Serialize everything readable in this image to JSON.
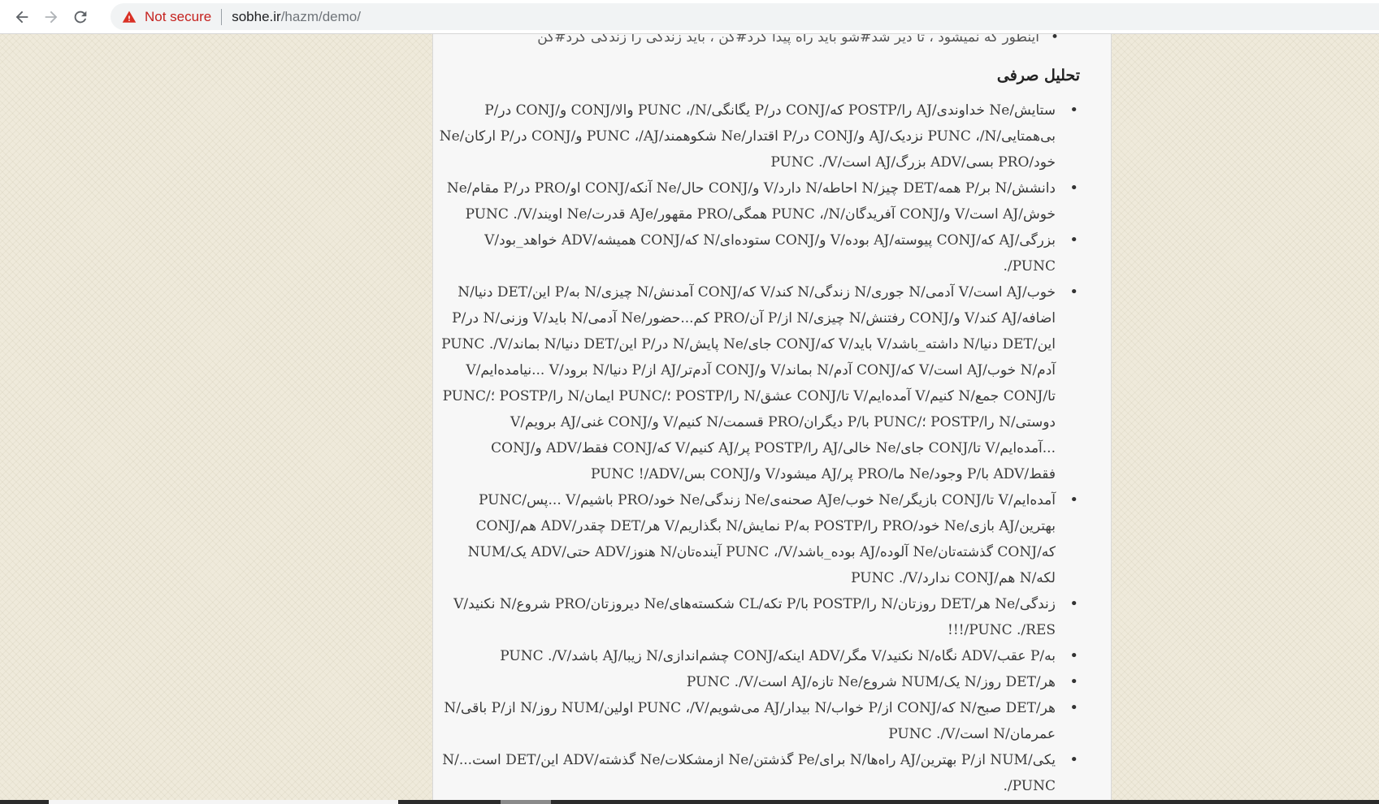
{
  "browser": {
    "security_label": "Not secure",
    "url_host": "sobhe.ir",
    "url_path": "/hazm/demo/"
  },
  "page": {
    "cut_off_line": "اینطور که نمیشود ، تا دیر شد#شو باید راه پیدا کرد#کن ، باید زندگی را زندگی کرد#کن",
    "section_heading": "تحلیل صرفی",
    "items": [
      "ستایش/Ne خداوندی/AJ را/POSTP که/CONJ در/P یگانگی/PUNC ،/N والا/CONJ و/CONJ در/P بی‌همتایی/PUNC ،/N نزدیک/AJ و/CONJ در/P اقتدار/Ne شکوهمند/PUNC ،/AJ و/CONJ در/P ارکان/Ne خود/PRO بسی/ADV بزرگ/AJ است/PUNC ./V",
      "دانشش/N بر/P همه/DET چیز/N احاطه/N دارد/V و/CONJ حال/Ne آنکه/CONJ او/PRO در/P مقام/Ne خوش/AJ است/V و/CONJ آفریدگان/PUNC ،/N همگی/PRO مقهور/AJe قدرت/Ne اویند/PUNC ./V",
      "بزرگی/AJ که/CONJ پیوسته/AJ بوده/V و/CONJ ستوده‌ای/N که/CONJ همیشه/ADV خواهد_بود/V ./PUNC",
      "خوب/AJ است/V آدمی/N جوری/N زندگی/N کند/V که/CONJ آمدنش/N چیزی/N به/P این/DET دنیا/N اضافه/AJ کند/V و/CONJ رفتنش/N چیزی/N از/P آن/PRO کم...حضور/Ne آدمی/N باید/V وزنی/N در/P این/DET دنیا/N داشته_باشد/V باید/V که/CONJ جای/Ne پایش/N در/P این/DET دنیا/N بماند/PUNC ./V آدم/N خوب/AJ است/V که/CONJ آدم/N بماند/V و/CONJ آدم‌تر/AJ از/P دنیا/N برود/V ...نیامده‌ایم/V تا/CONJ جمع/N کنیم/V آمده‌ایم/V تا/CONJ عشق/N را/POSTP ؛/PUNC ایمان/N را/POSTP ؛/PUNC دوستی/N را/POSTP ؛/PUNC با/P دیگران/PRO قسمت/N کنیم/V و/CONJ غنی/AJ برویم/V ...آمده‌ایم/V تا/CONJ جای/Ne خالی/AJ را/POSTP پر/AJ کنیم/V که/CONJ فقط/ADV و/CONJ فقط/ADV با/P وجود/Ne ما/PRO پر/AJ میشود/V و/CONJ بس/PUNC !/ADV",
      "آمده‌ایم/V تا/CONJ بازیگر/Ne خوب/AJe صحنه‌ی/Ne زندگی/Ne خود/PRO باشیم/V ...پس/PUNC بهترین/AJ بازی/Ne خود/PRO را/POSTP به/P نمایش/N بگذاریم/V هر/DET چقدر/ADV هم/CONJ که/CONJ گذشته‌تان/Ne آلوده/AJ بوده_باشد/PUNC ،/V آینده‌تان/N هنوز/ADV حتی/ADV یک/NUM لکه/N هم/CONJ ندارد/PUNC ./V",
      "زندگی/Ne هر/DET روزتان/N را/POSTP با/P تکه/CL شکسته‌های/Ne دیروزتان/PRO شروع/N نکنید/V !!!/PUNC ./RES",
      "به/P عقب/ADV نگاه/N نکنید/V مگر/ADV اینکه/CONJ چشم‌اندازی/N زیبا/AJ باشد/PUNC ./V",
      "هر/DET روز/N یک/NUM شروع/Ne تازه/AJ است/PUNC ./V",
      "هر/DET صبح/N که/CONJ از/P خواب/N بیدار/AJ می‌شویم/PUNC ،/V اولین/NUM روز/N از/P باقی/N عمرمان/N است/PUNC ./V",
      "یکی/NUM از/P بهترین/AJ راه‌ها/N برای/Pe گذشتن/Ne ازمشکلات/Ne گذشته/ADV این/DET است.../N ./PUNC"
    ]
  }
}
